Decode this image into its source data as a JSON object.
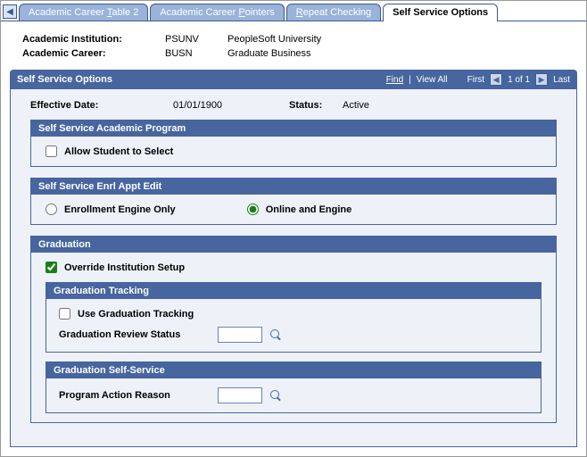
{
  "tabs": {
    "t1": "Academic Career Table 2",
    "t2": "Academic Career Pointers",
    "t3": "Repeat Checking",
    "t4": "Self Service Options"
  },
  "header": {
    "institution_label": "Academic Institution:",
    "institution_code": "PSUNV",
    "institution_name": "PeopleSoft University",
    "career_label": "Academic Career:",
    "career_code": "BUSN",
    "career_name": "Graduate Business"
  },
  "section": {
    "title": "Self Service Options",
    "find": "Find",
    "view_all": "View All",
    "first": "First",
    "position": "1 of 1",
    "last": "Last"
  },
  "effective": {
    "date_label": "Effective Date:",
    "date_value": "01/01/1900",
    "status_label": "Status:",
    "status_value": "Active"
  },
  "academic_program": {
    "title": "Self Service Academic Program",
    "allow_select_label": "Allow Student to Select",
    "allow_select_checked": false
  },
  "enrl_appt": {
    "title": "Self Service Enrl Appt Edit",
    "opt_engine_only": "Enrollment Engine Only",
    "opt_online_engine": "Online and Engine",
    "selected": "online_engine"
  },
  "graduation": {
    "title": "Graduation",
    "override_label": "Override Institution Setup",
    "override_checked": true,
    "tracking": {
      "title": "Graduation Tracking",
      "use_tracking_label": "Use Graduation Tracking",
      "use_tracking_checked": false,
      "review_status_label": "Graduation Review Status",
      "review_status_value": ""
    },
    "self_service": {
      "title": "Graduation Self-Service",
      "program_action_reason_label": "Program Action Reason",
      "program_action_reason_value": ""
    }
  }
}
